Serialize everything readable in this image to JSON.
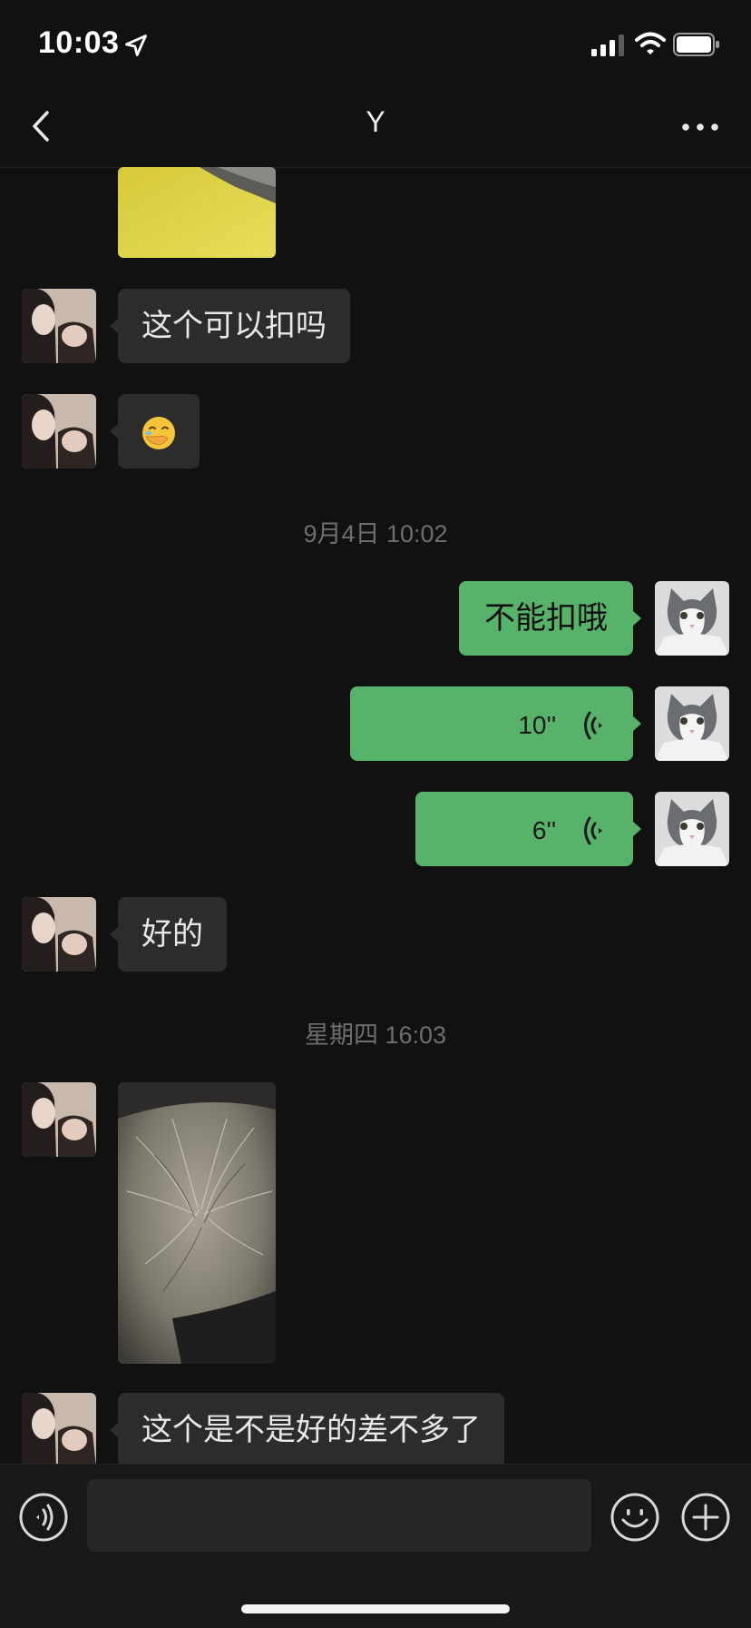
{
  "status_bar": {
    "time": "10:03",
    "icons": [
      "location-arrow-icon",
      "cellular-signal-icon",
      "wifi-icon",
      "battery-icon"
    ]
  },
  "nav": {
    "title": "Y",
    "back_icon": "chevron-left-icon",
    "more_icon": "more-dots-icon"
  },
  "colors": {
    "background": "#111111",
    "incoming_bubble": "#2c2c2c",
    "outgoing_bubble": "#58b36a",
    "timestamp_text": "#6e6e6e"
  },
  "messages": [
    {
      "type": "image",
      "side": "left",
      "content": "yellow fabric with fur photo (partially scrolled)"
    },
    {
      "type": "text",
      "side": "left",
      "text": "这个可以扣吗"
    },
    {
      "type": "text",
      "side": "left",
      "text": "🤭"
    },
    {
      "type": "timestamp",
      "text": "9月4日 10:02"
    },
    {
      "type": "text",
      "side": "right",
      "text": "不能扣哦"
    },
    {
      "type": "voice",
      "side": "right",
      "duration": "10''"
    },
    {
      "type": "voice",
      "side": "right",
      "duration": "6''"
    },
    {
      "type": "text",
      "side": "left",
      "text": "好的"
    },
    {
      "type": "timestamp",
      "text": "星期四 16:03"
    },
    {
      "type": "image",
      "side": "left",
      "content": "close-up fur photo"
    },
    {
      "type": "text",
      "side": "left",
      "text": "这个是不是好的差不多了"
    }
  ],
  "input_bar": {
    "placeholder": "",
    "icons": [
      "voice-toggle-icon",
      "emoji-icon",
      "plus-icon"
    ]
  }
}
